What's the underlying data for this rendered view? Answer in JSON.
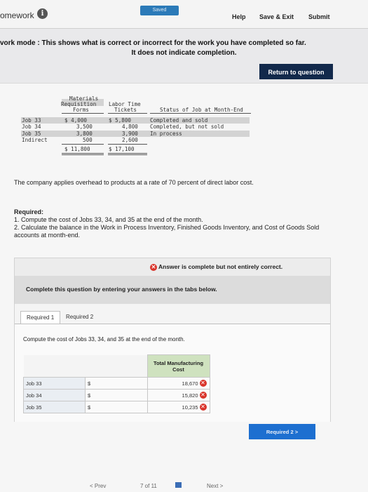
{
  "header": {
    "brand": "omework",
    "saved_label": "Saved",
    "help": "Help",
    "save_exit": "Save & Exit",
    "submit": "Submit"
  },
  "mode_message": {
    "line1": "vork mode : This shows what is correct or incorrect for the work you have completed so far.",
    "line2": "It does not indicate completion."
  },
  "return_button": "Return to question",
  "source_table": {
    "headers": {
      "materials": [
        "Materials",
        "Requisition",
        "Forms"
      ],
      "labor": [
        "Labor Time",
        "Tickets"
      ],
      "status": "Status of Job at Month-End"
    },
    "rows": [
      {
        "label": "Job 33",
        "materials": "$ 4,000",
        "labor": "$ 5,800",
        "status": "Completed and sold"
      },
      {
        "label": "Job 34",
        "materials": "3,500",
        "labor": "4,800",
        "status": "Completed, but not sold"
      },
      {
        "label": "Job 35",
        "materials": "3,800",
        "labor": "3,900",
        "status": "In process"
      },
      {
        "label": "Indirect",
        "materials": "500",
        "labor": "2,600",
        "status": ""
      }
    ],
    "totals": {
      "materials": "$ 11,800",
      "labor": "$ 17,100"
    }
  },
  "overhead_text": "The company applies overhead to products at a rate of 70 percent of direct labor cost.",
  "required": {
    "title": "Required:",
    "item1": "1. Compute the cost of Jobs 33, 34, and 35 at the end of the month.",
    "item2": "2. Calculate the balance in the Work in Process Inventory, Finished Goods Inventory, and Cost of Goods Sold accounts at month-end."
  },
  "answer": {
    "status": "Answer is complete but not entirely correct.",
    "instruction": "Complete this question by entering your answers in the tabs below.",
    "tabs": [
      "Required 1",
      "Required 2"
    ],
    "prompt": "Compute the cost of Jobs 33, 34, and 35 at the end of the month.",
    "table_header": "Total Manufacturing Cost",
    "rows": [
      {
        "label": "Job 33",
        "currency": "$",
        "value": "18,670"
      },
      {
        "label": "Job 34",
        "currency": "$",
        "value": "15,820"
      },
      {
        "label": "Job 35",
        "currency": "$",
        "value": "10,235"
      }
    ]
  },
  "next_tab_button": "Required 2  >",
  "footer": {
    "prev": "< Prev",
    "page": "7 of 11",
    "next": "Next >"
  },
  "colors": {
    "accent": "#1d6fd0",
    "dark_button": "#12294b",
    "error": "#d9342b",
    "header_green": "#cfe2bf"
  }
}
